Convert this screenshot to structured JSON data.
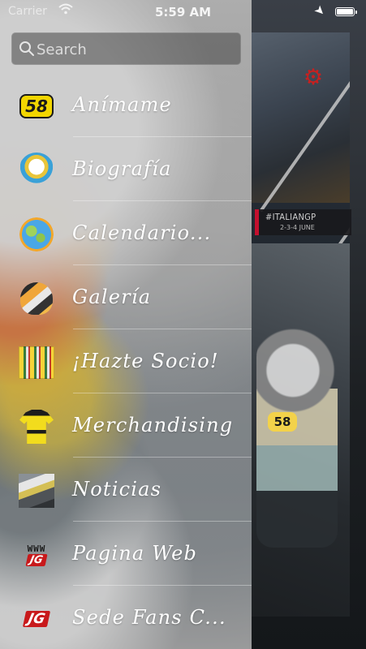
{
  "status_bar": {
    "carrier": "Carrier",
    "time": "5:59 AM",
    "battery_level": 1.0
  },
  "search": {
    "placeholder": "Search"
  },
  "menu": {
    "items": [
      {
        "label": "Anímame",
        "icon": "number-58-icon"
      },
      {
        "label": "Biografía",
        "icon": "rooster-mascot-icon"
      },
      {
        "label": "Calendario...",
        "icon": "globe-icon"
      },
      {
        "label": "Galería",
        "icon": "helmet-icon"
      },
      {
        "label": "¡Hazte Socio!",
        "icon": "fan-crowd-icon"
      },
      {
        "label": "Merchandising",
        "icon": "shirt-icon"
      },
      {
        "label": "Noticias",
        "icon": "news-photo-icon"
      },
      {
        "label": "Pagina Web",
        "icon": "website-icon"
      },
      {
        "label": "Sede Fans C...",
        "icon": "jg-logo-icon"
      }
    ],
    "icon_text": {
      "number": "58",
      "www": "WWW",
      "jg": "JG"
    }
  },
  "background": {
    "event_hashtag": "#ITALIANGP",
    "event_dates": "2-3-4 JUNE",
    "bike_number": "58"
  },
  "colors": {
    "accent_red": "#c8191b",
    "gear_red": "#c8201f",
    "yellow": "#f2d600"
  }
}
